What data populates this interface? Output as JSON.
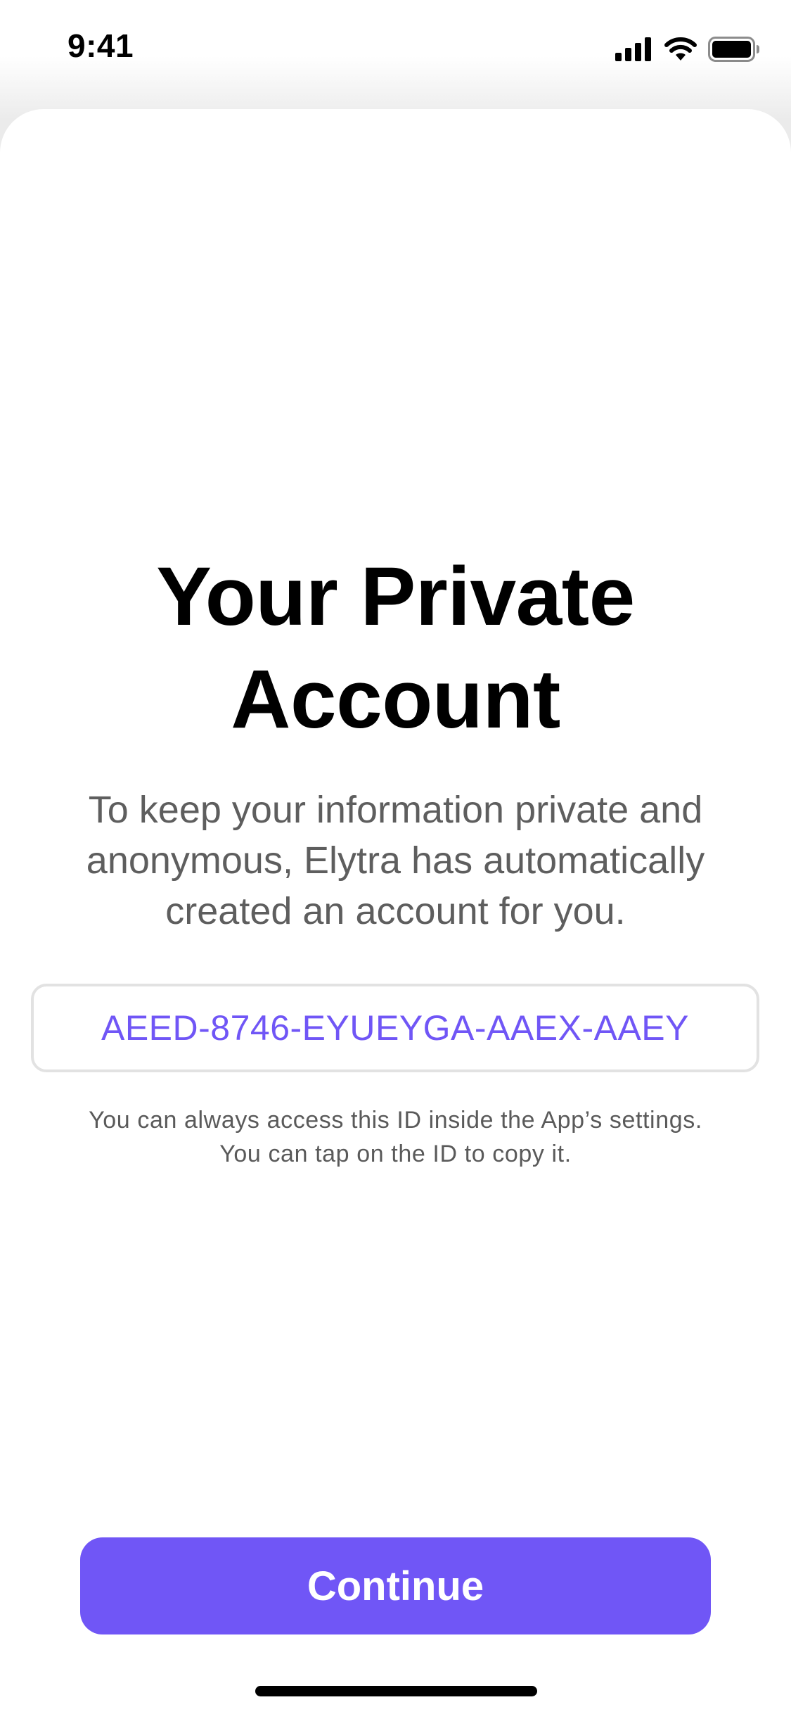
{
  "status_bar": {
    "time": "9:41",
    "icons": [
      "cellular-signal-icon",
      "wifi-icon",
      "battery-icon"
    ]
  },
  "screen": {
    "title_line1": "Your Private",
    "title_line2": "Account",
    "subtitle_line1": "To keep your information private and",
    "subtitle_line2": "anonymous, Elytra has automatically",
    "subtitle_line3": "created an account for you.",
    "account_id": "AEED-8746-EYUEYGA-AAEX-AAEY",
    "note_line1": "You can always access this ID inside the App’s settings.",
    "note_line2": "You can tap on the ID to copy it."
  },
  "actions": {
    "continue_label": "Continue"
  },
  "colors": {
    "accent": "#7056F6",
    "title": "#000000",
    "body_text": "#5E5E5E",
    "id_border": "#E2E2E2"
  }
}
